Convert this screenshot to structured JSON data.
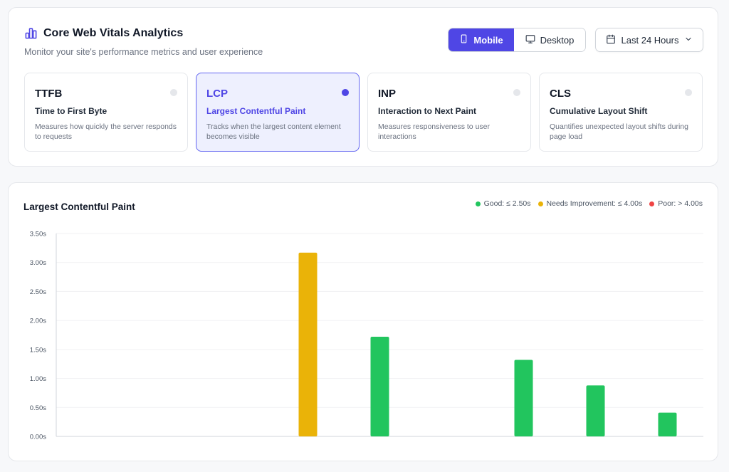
{
  "header": {
    "title": "Core Web Vitals Analytics",
    "subtitle": "Monitor your site's performance metrics and user experience",
    "title_icon": "bar-chart-icon"
  },
  "device_toggle": {
    "mobile_label": "Mobile",
    "desktop_label": "Desktop",
    "selected": "Mobile"
  },
  "time_range": {
    "label": "Last 24 Hours"
  },
  "metrics": [
    {
      "abbr": "TTFB",
      "name": "Time to First Byte",
      "desc": "Measures how quickly the server responds to requests",
      "active": false
    },
    {
      "abbr": "LCP",
      "name": "Largest Contentful Paint",
      "desc": "Tracks when the largest content element becomes visible",
      "active": true
    },
    {
      "abbr": "INP",
      "name": "Interaction to Next Paint",
      "desc": "Measures responsiveness to user interactions",
      "active": false
    },
    {
      "abbr": "CLS",
      "name": "Cumulative Layout Shift",
      "desc": "Quantifies unexpected layout shifts during page load",
      "active": false
    }
  ],
  "legend": {
    "good": "Good: ≤ 2.50s",
    "needs": "Needs Improvement: ≤ 4.00s",
    "poor": "Poor: > 4.00s"
  },
  "colors": {
    "accent": "#4f46e5",
    "good": "#22c55e",
    "needs": "#eab308",
    "poor": "#ef4444"
  },
  "chart_data": {
    "type": "bar",
    "title": "Largest Contentful Paint",
    "ylim": [
      0,
      3.5
    ],
    "yticks": [
      "0.00s",
      "0.50s",
      "1.00s",
      "1.50s",
      "2.00s",
      "2.50s",
      "3.00s",
      "3.50s"
    ],
    "values": [
      0,
      0,
      0,
      3.17,
      1.72,
      0,
      1.32,
      0.88,
      0.41
    ],
    "status": [
      "good",
      "good",
      "good",
      "needs",
      "good",
      "good",
      "good",
      "good",
      "good"
    ],
    "grid": true
  }
}
